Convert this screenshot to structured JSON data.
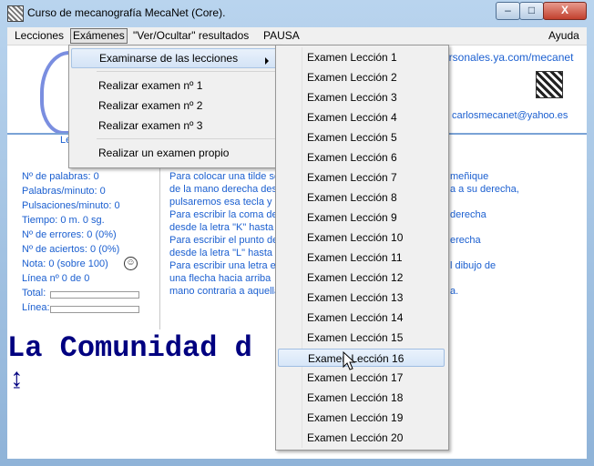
{
  "window": {
    "title": "Curso de mecanografía MecaNet (Core).",
    "min_glyph": "–",
    "max_glyph": "□",
    "close_glyph": "X"
  },
  "menubar": {
    "lecciones": "Lecciones",
    "examenes": "Exámenes",
    "ver_ocultar": "\"Ver/Ocultar\" resultados",
    "pausa": "PAUSA",
    "ayuda": "Ayuda"
  },
  "header": {
    "web": "ersonales.ya.com/mecanet",
    "email": "carlosmecanet@yahoo.es"
  },
  "stats": {
    "heading": "Le",
    "palabras": "Nº de palabras: 0",
    "ppm": "Palabras/minuto: 0",
    "pulsaciones": "Pulsaciones/minuto: 0",
    "tiempo": "Tiempo: 0 m. 0 sg.",
    "errores": "Nº de errores: 0 (0%)",
    "aciertos": "Nº de aciertos: 0 (0%)",
    "nota": "Nota: 0 (sobre 100)",
    "linea": "Línea nº 0 de 0",
    "total_label": "Total:",
    "linea_label": "Línea:",
    "smiley": "☺"
  },
  "instructions": {
    "l1": "Para colocar una tilde sc",
    "l2": "de la mano derecha des",
    "l3": "pulsaremos esa tecla y",
    "l4": "Para escribir la coma de",
    "l5": "desde la letra \"K\" hasta",
    "l6": "Para escribir el punto de",
    "l7": "desde la letra \"L\" hasta",
    "l8": "Para escribir una letra e",
    "l9": "una flecha hacia arriba",
    "l10": "mano contraria a aquella",
    "r1": "meñique",
    "r2": "a a su derecha,",
    "r4": "derecha",
    "r6": "erecha",
    "r8": "l dibujo de",
    "r10": "a."
  },
  "typing": {
    "line": "La Comunidad d        . es la",
    "cursor": "↨"
  },
  "examenes_menu": {
    "examinarse": "Examinarse de las lecciones",
    "ex1": "Realizar examen nº 1",
    "ex2": "Realizar examen nº 2",
    "ex3": "Realizar examen nº 3",
    "propio": "Realizar un examen propio"
  },
  "lecciones_submenu": [
    "Examen Lección 1",
    "Examen Lección 2",
    "Examen Lección 3",
    "Examen Lección 4",
    "Examen Lección 5",
    "Examen Lección 6",
    "Examen Lección 7",
    "Examen Lección 8",
    "Examen Lección 9",
    "Examen Lección 10",
    "Examen Lección 11",
    "Examen Lección 12",
    "Examen Lección 13",
    "Examen Lección 14",
    "Examen Lección 15",
    "Examen Lección 16",
    "Examen Lección 17",
    "Examen Lección 18",
    "Examen Lección 19",
    "Examen Lección 20"
  ],
  "hovered_item": "Examen Lección 16"
}
